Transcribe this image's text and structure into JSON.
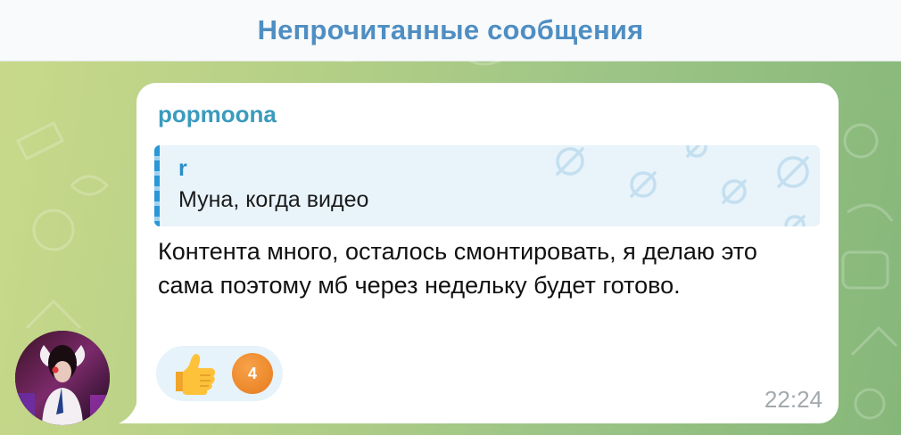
{
  "header": {
    "title": "Непрочитанные сообщения"
  },
  "message": {
    "sender": "popmoona",
    "reply": {
      "author": "r",
      "text": "Муна, когда видео"
    },
    "text": "Контента много, осталось смонтировать, я делаю это сама поэтому мб через недельку будет готово.",
    "reaction": {
      "emoji": "thumbs-up-emoji",
      "count": "4"
    },
    "time": "22:24"
  },
  "colors": {
    "header_title": "#4f8ec2",
    "sender": "#3a9bbd",
    "reply_accent": "#2a97d6",
    "reaction_count_bg": "#ee8a2e",
    "time": "#a2a9ad"
  }
}
